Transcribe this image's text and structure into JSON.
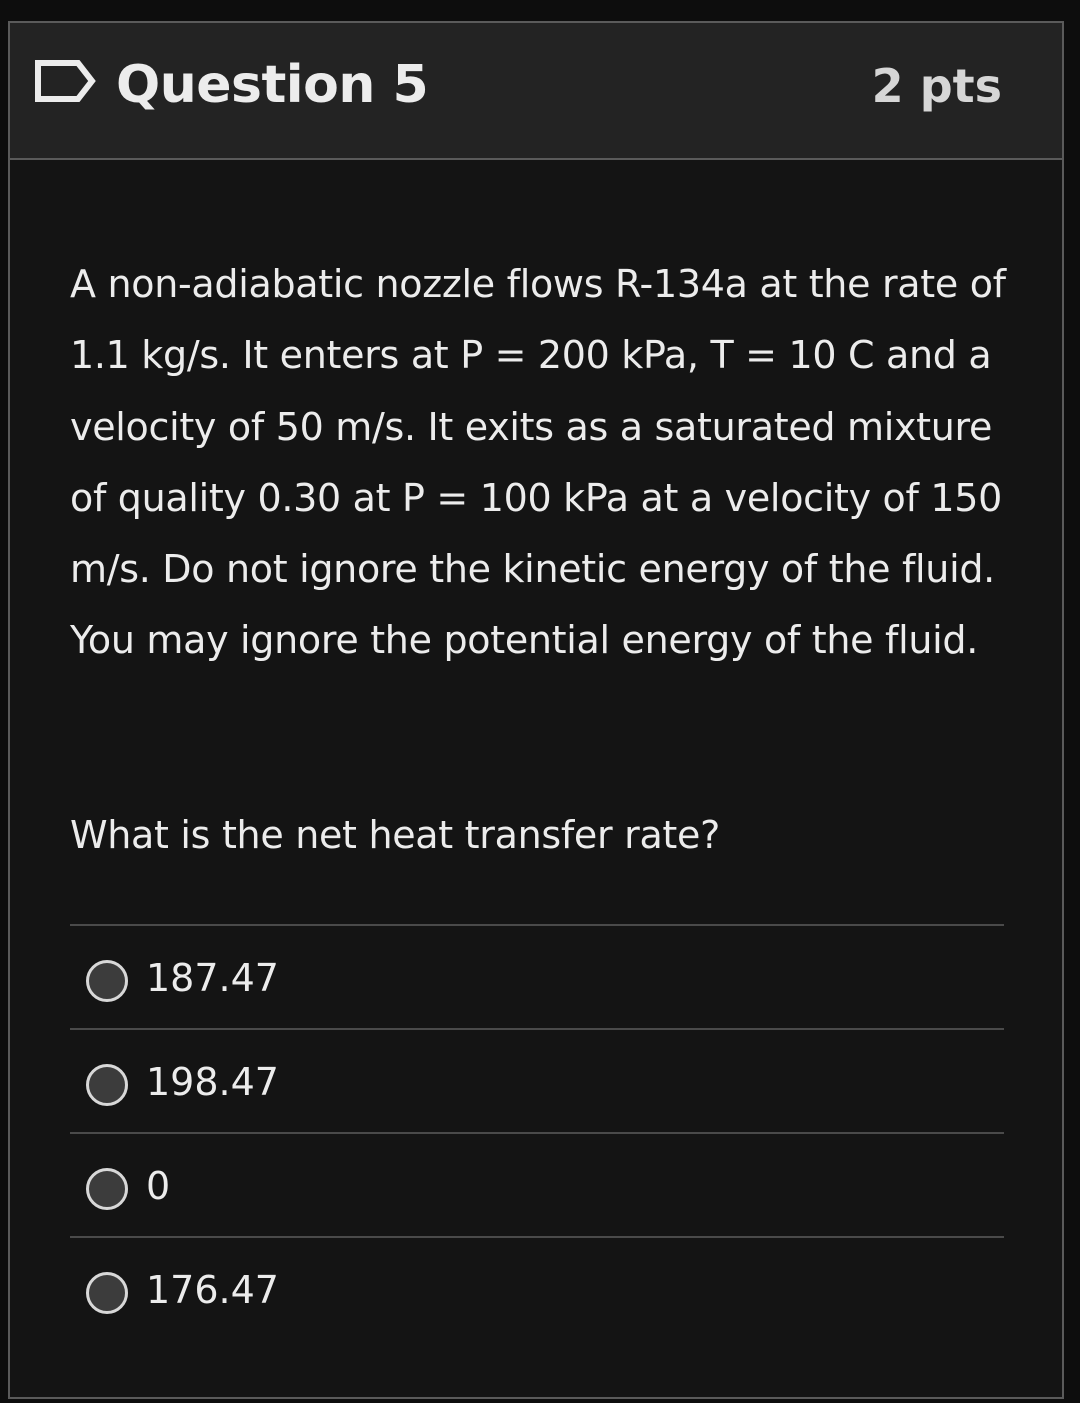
{
  "question": {
    "title": "Question 5",
    "points": "2 pts",
    "text": "A non-adiabatic nozzle flows R-134a at the rate of 1.1 kg/s.  It enters at P = 200 kPa, T = 10 C and a velocity of 50 m/s.  It exits as a saturated mixture of quality 0.30 at P = 100 kPa at a velocity of 150 m/s.  Do not ignore the kinetic energy of the fluid.  You may ignore the potential energy of the fluid.",
    "prompt": "What is the net heat transfer rate?"
  },
  "answers": [
    {
      "label": "187.47"
    },
    {
      "label": "198.47"
    },
    {
      "label": "0"
    },
    {
      "label": "176.47"
    }
  ],
  "icons": {
    "flag": "flag-icon",
    "radio": "radio-icon"
  },
  "colors": {
    "background": "#141414",
    "header": "#232323",
    "border": "#5a5a5a",
    "text": "#ececec",
    "radio_fill": "#3c3c3c"
  }
}
